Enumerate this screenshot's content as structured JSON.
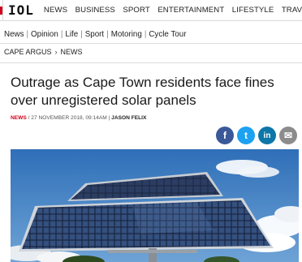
{
  "header": {
    "logo": "IOL",
    "nav": [
      "NEWS",
      "BUSINESS",
      "SPORT",
      "ENTERTAINMENT",
      "LIFESTYLE",
      "TRAVEL"
    ]
  },
  "subnav": [
    "News",
    "Opinion",
    "Life",
    "Sport",
    "Motoring",
    "Cycle Tour"
  ],
  "breadcrumb": {
    "parent": "CAPE ARGUS",
    "current": "NEWS"
  },
  "article": {
    "headline": "Outrage as Cape Town residents face fines over unregistered solar panels",
    "section": "NEWS",
    "date": "27 NOVEMBER 2018, 09:14AM",
    "author": "JASON FELIX"
  },
  "share": {
    "facebook": "f",
    "twitter": "t",
    "linkedin": "in",
    "email": "✉"
  },
  "colors": {
    "accent": "#d0021b",
    "facebook": "#3b5998",
    "twitter": "#1da1f2",
    "linkedin": "#0e76a8",
    "email": "#8c8c8c"
  },
  "icons": [
    "menu-icon",
    "chevron-right-icon",
    "facebook-icon",
    "twitter-icon",
    "linkedin-icon",
    "email-icon"
  ]
}
